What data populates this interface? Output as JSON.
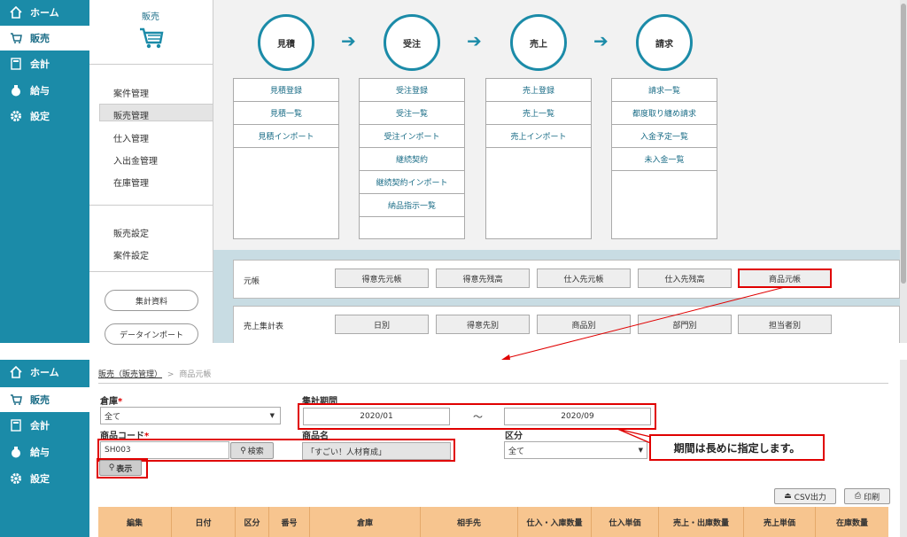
{
  "nav": {
    "items": [
      {
        "label": "ホーム",
        "icon": "home-icon"
      },
      {
        "label": "販売",
        "icon": "cart-icon"
      },
      {
        "label": "会計",
        "icon": "calculator-icon"
      },
      {
        "label": "給与",
        "icon": "yen-bag-icon"
      },
      {
        "label": "設定",
        "icon": "gear-icon"
      }
    ]
  },
  "top": {
    "section_title": "販売",
    "submenu": [
      "案件管理",
      "販売管理",
      "仕入管理",
      "入出金管理",
      "在庫管理"
    ],
    "submenu2": [
      "販売設定",
      "案件設定"
    ],
    "pills": [
      "集計資料",
      "データインポート"
    ],
    "flow": [
      {
        "title": "見積",
        "items": [
          "見積登録",
          "見積一覧",
          "見積インポート"
        ]
      },
      {
        "title": "受注",
        "items": [
          "受注登録",
          "受注一覧",
          "受注インポート",
          "継続契約",
          "継続契約インポート",
          "納品指示一覧"
        ]
      },
      {
        "title": "売上",
        "items": [
          "売上登録",
          "売上一覧",
          "売上インポート"
        ]
      },
      {
        "title": "請求",
        "items": [
          "請求一覧",
          "都度取り纏め請求",
          "入金予定一覧",
          "未入金一覧"
        ]
      }
    ],
    "ledger": {
      "label": "元帳",
      "buttons": [
        "得意先元帳",
        "得意先残高",
        "仕入先元帳",
        "仕入先残高",
        "商品元帳"
      ]
    },
    "summary": {
      "label": "売上集計表",
      "buttons": [
        "日別",
        "得意先別",
        "商品別",
        "部門別",
        "担当者別"
      ]
    }
  },
  "bottom": {
    "breadcrumb_link": "販売（販売管理）",
    "breadcrumb_sep": ">",
    "breadcrumb_current": "商品元帳",
    "warehouse_label": "倉庫",
    "warehouse_value": "全て",
    "period_label": "集計期間",
    "period_from": "2020/01",
    "period_sep": "〜",
    "period_to": "2020/09",
    "code_label": "商品コード",
    "code_value": "SH003",
    "search_button": "検索",
    "name_label": "商品名",
    "name_value": "「すごい！人材育成」",
    "kubun_label": "区分",
    "kubun_value": "全て",
    "show_button": "表示",
    "callout": "期間は長めに指定します。",
    "csv_button": "CSV出力",
    "print_button": "印刷",
    "columns": [
      "編集",
      "日付",
      "区分",
      "番号",
      "倉庫",
      "相手先",
      "仕入・入庫数量",
      "仕入単価",
      "売上・出庫数量",
      "売上単価",
      "在庫数量"
    ]
  },
  "colors": {
    "nav": "#1b8ba8",
    "accent_red": "#e00000",
    "table_header": "#f7c58f"
  }
}
